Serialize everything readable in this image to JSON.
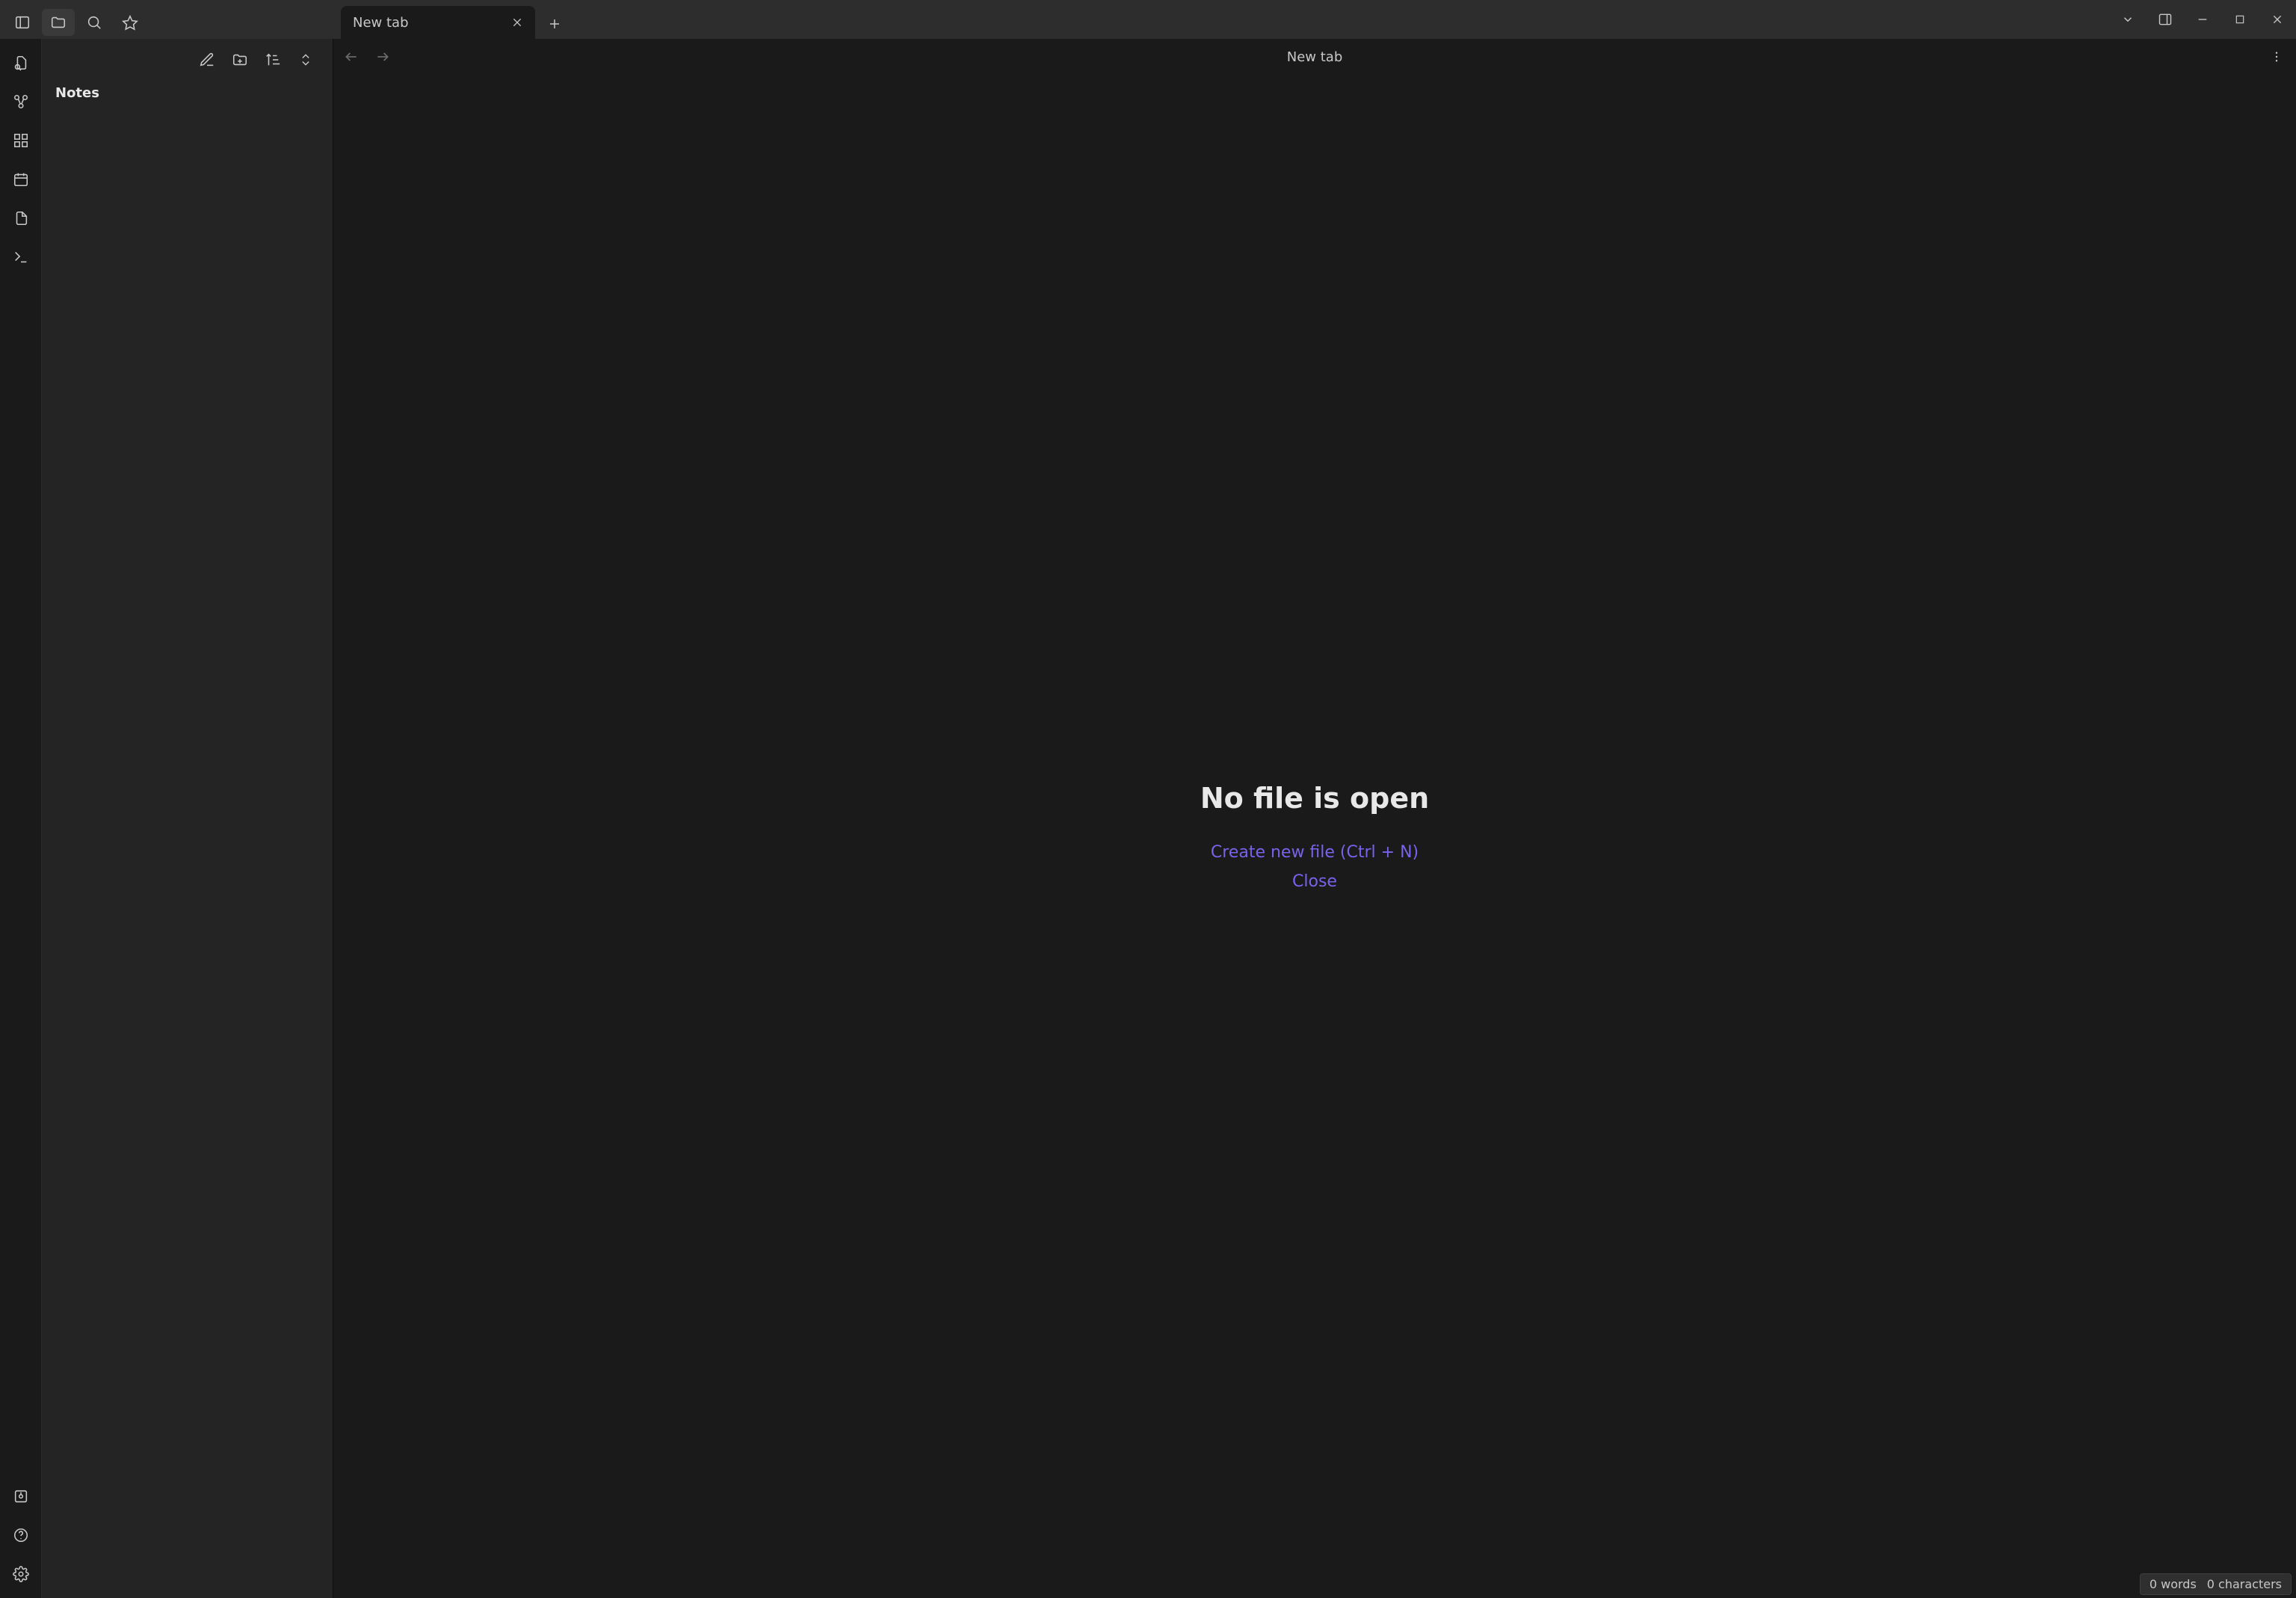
{
  "tab": {
    "label": "New tab"
  },
  "crumb": {
    "label": "New tab"
  },
  "sidebar": {
    "root_label": "Notes"
  },
  "empty": {
    "title": "No file is open",
    "create_label": "Create new file (Ctrl + N)",
    "close_label": "Close"
  },
  "status": {
    "words": "0 words",
    "chars": "0 characters"
  }
}
